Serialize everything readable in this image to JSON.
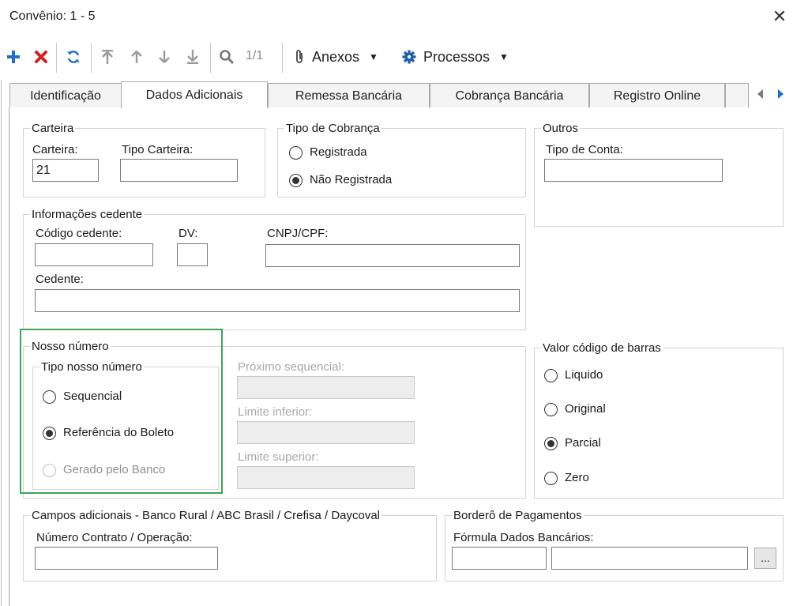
{
  "window": {
    "title": "Convênio: 1 - 5"
  },
  "toolbar": {
    "record_counter": "1/1",
    "anexos_label": "Anexos",
    "processos_label": "Processos",
    "colors": {
      "add": "#1f6fc9",
      "delete": "#d21f1f",
      "refresh": "#1f6fc9",
      "nav": "#9a9a9a",
      "search": "#7a7a7a",
      "gear": "#1f5fa8"
    }
  },
  "tabs": [
    {
      "label": "Identificação",
      "active": false
    },
    {
      "label": "Dados Adicionais",
      "active": true
    },
    {
      "label": "Remessa Bancária",
      "active": false
    },
    {
      "label": "Cobrança Bancária",
      "active": false
    },
    {
      "label": "Registro Online",
      "active": false
    }
  ],
  "carteira": {
    "legend": "Carteira",
    "carteira_label": "Carteira:",
    "carteira_value": "21",
    "tipo_label": "Tipo Carteira:",
    "tipo_value": ""
  },
  "tipo_cobranca": {
    "legend": "Tipo de Cobrança",
    "options": [
      {
        "label": "Registrada",
        "selected": false
      },
      {
        "label": "Não Registrada",
        "selected": true
      }
    ]
  },
  "outros": {
    "legend": "Outros",
    "tipo_conta_label": "Tipo de Conta:",
    "tipo_conta_value": ""
  },
  "cedente": {
    "legend": "Informações cedente",
    "codigo_label": "Código cedente:",
    "dv_label": "DV:",
    "cnpj_label": "CNPJ/CPF:",
    "cedente_label": "Cedente:"
  },
  "nosso_numero": {
    "legend": "Nosso número",
    "tipo_legend": "Tipo nosso número",
    "options": [
      {
        "label": "Sequencial",
        "selected": false,
        "disabled": false
      },
      {
        "label": "Referência do Boleto",
        "selected": true,
        "disabled": false
      },
      {
        "label": "Gerado pelo Banco",
        "selected": false,
        "disabled": true
      }
    ],
    "proximo_label": "Próximo sequencial:",
    "limite_inferior_label": "Limite inferior:",
    "limite_superior_label": "Limite superior:"
  },
  "valor_codigo": {
    "legend": "Valor código de barras",
    "options": [
      {
        "label": "Liquido",
        "selected": false
      },
      {
        "label": "Original",
        "selected": false
      },
      {
        "label": "Parcial",
        "selected": true
      },
      {
        "label": "Zero",
        "selected": false
      }
    ]
  },
  "campos_adicionais": {
    "legend": "Campos adicionais - Banco Rural / ABC Brasil / Crefisa / Daycoval",
    "contrato_label": "Número Contrato / Operação:"
  },
  "bordero": {
    "legend": "Borderô de Pagamentos",
    "formula_label": "Fórmula Dados Bancários:",
    "browse_label": "..."
  }
}
